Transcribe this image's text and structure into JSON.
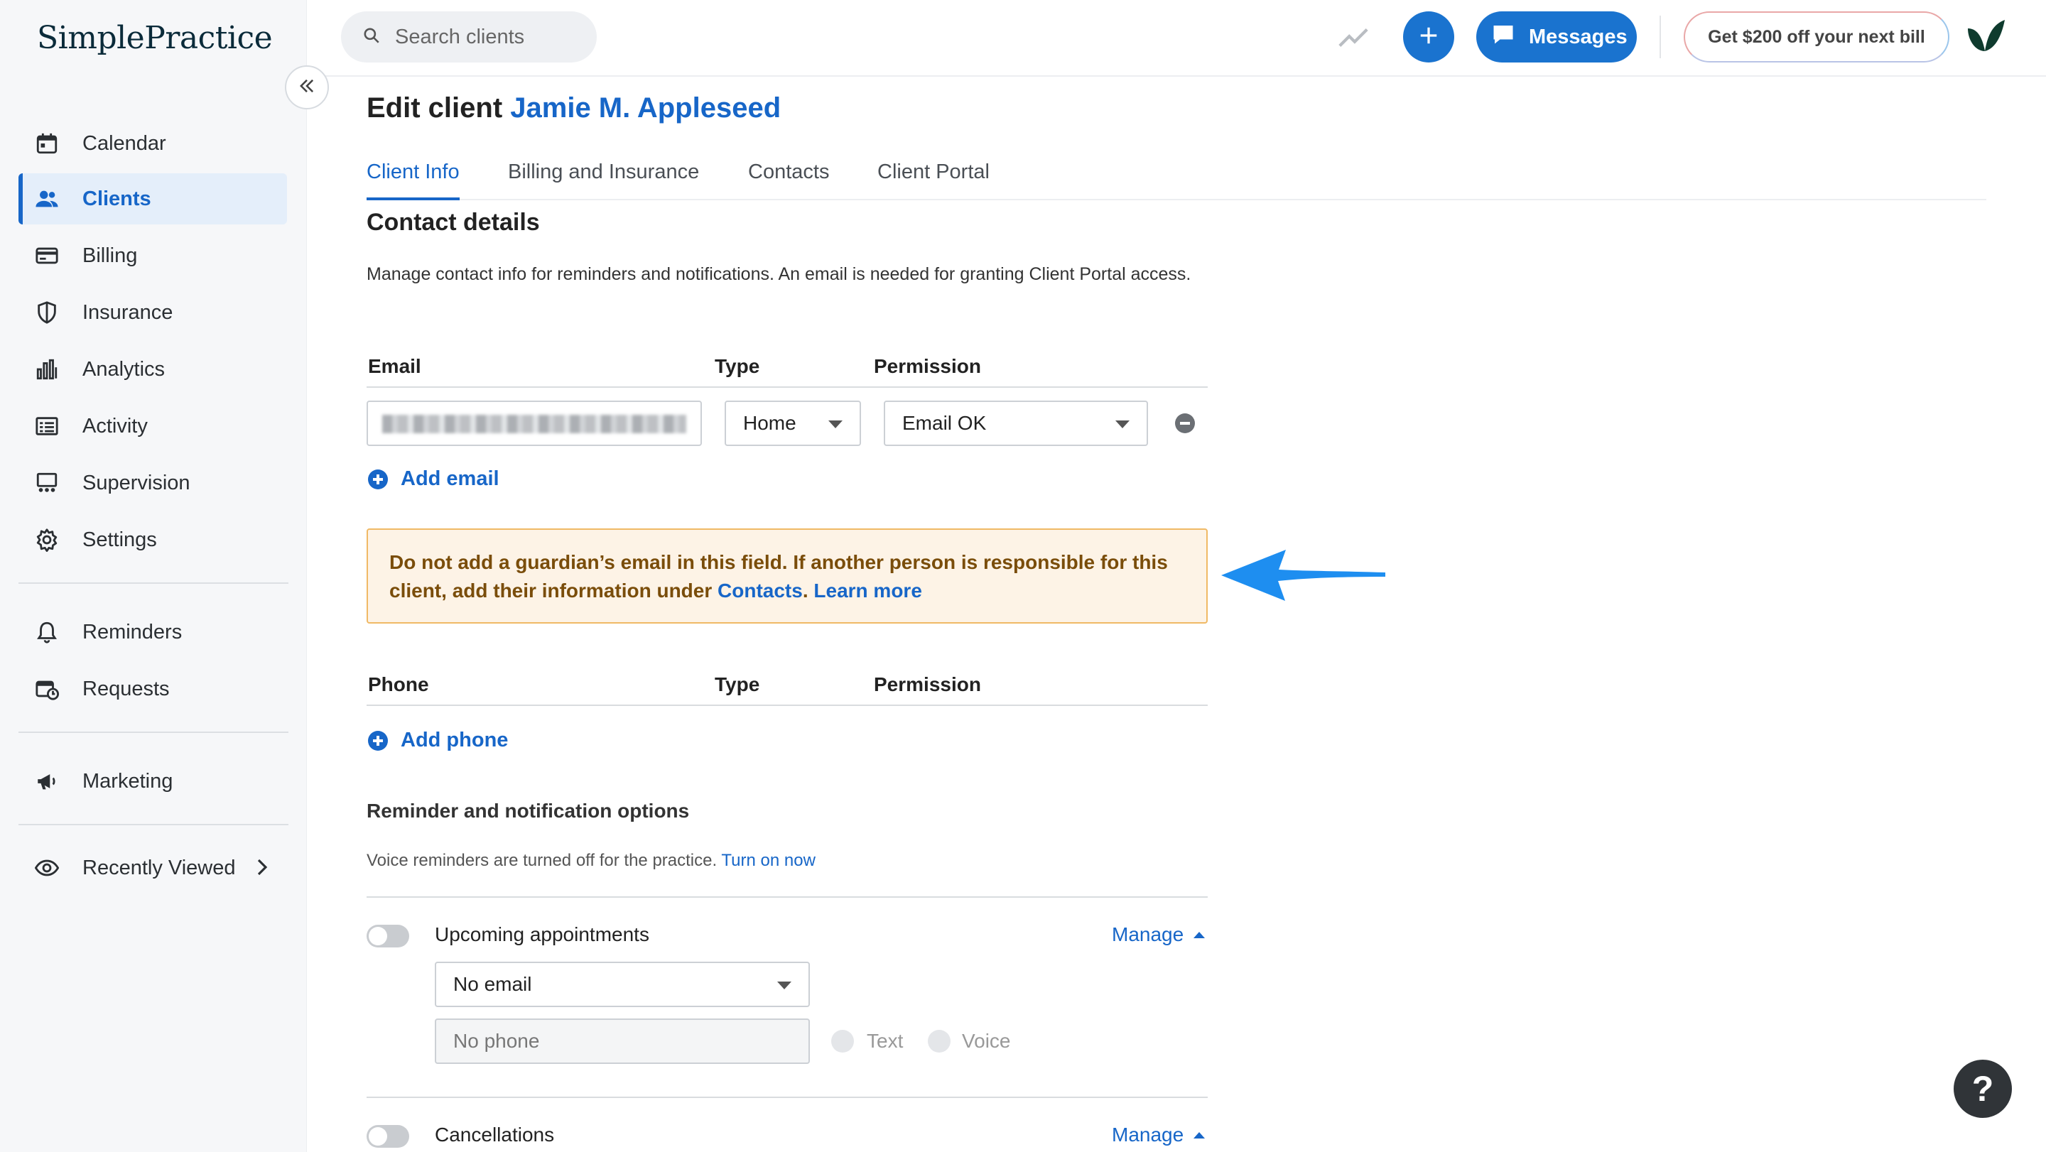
{
  "app": {
    "logo_text": "SimplePractice"
  },
  "sidebar": {
    "items": [
      {
        "label": "Calendar",
        "icon": "calendar-icon"
      },
      {
        "label": "Clients",
        "icon": "clients-icon",
        "active": true
      },
      {
        "label": "Billing",
        "icon": "billing-icon"
      },
      {
        "label": "Insurance",
        "icon": "shield-icon"
      },
      {
        "label": "Analytics",
        "icon": "analytics-icon"
      },
      {
        "label": "Activity",
        "icon": "activity-icon"
      },
      {
        "label": "Supervision",
        "icon": "supervision-icon"
      },
      {
        "label": "Settings",
        "icon": "gear-icon"
      },
      {
        "label": "Reminders",
        "icon": "bell-icon"
      },
      {
        "label": "Requests",
        "icon": "requests-icon"
      },
      {
        "label": "Marketing",
        "icon": "megaphone-icon"
      },
      {
        "label": "Recently Viewed",
        "icon": "eye-icon"
      }
    ]
  },
  "topbar": {
    "search_placeholder": "Search clients",
    "messages_label": "Messages",
    "promo_label": "Get $200 off your next bill"
  },
  "page": {
    "edit_label": "Edit client",
    "client_name": "Jamie M. Appleseed"
  },
  "tabs": [
    "Client Info",
    "Billing and Insurance",
    "Contacts",
    "Client Portal"
  ],
  "contact": {
    "title": "Contact details",
    "description": "Manage contact info for reminders and notifications. An email is needed for granting Client Portal access.",
    "email_header": "Email",
    "type_header": "Type",
    "permission_header": "Permission",
    "email_type": "Home",
    "email_permission": "Email OK",
    "add_email": "Add email",
    "warning_text": "Do not add a guardian’s email in this field. If another person is responsible for this client, add their information under ",
    "warning_link_contacts": "Contacts",
    "warning_period": ".",
    "warning_link_learn": "Learn more",
    "phone_header": "Phone",
    "phone_type_header": "Type",
    "phone_permission_header": "Permission",
    "add_phone": "Add phone"
  },
  "reminders": {
    "title": "Reminder and notification options",
    "voice_note": "Voice reminders are turned off for the practice.",
    "voice_link": "Turn on now",
    "upcoming_label": "Upcoming appointments",
    "manage_label": "Manage",
    "email_select": "No email",
    "phone_select": "No phone",
    "text_label": "Text",
    "voice_label": "Voice",
    "cancellations_label": "Cancellations"
  },
  "help": {
    "label": "?"
  },
  "colors": {
    "accent": "#1766c8",
    "warning_bg": "#fdf3e6",
    "warning_border": "#f0b965",
    "arrow": "#1e8ef0"
  }
}
